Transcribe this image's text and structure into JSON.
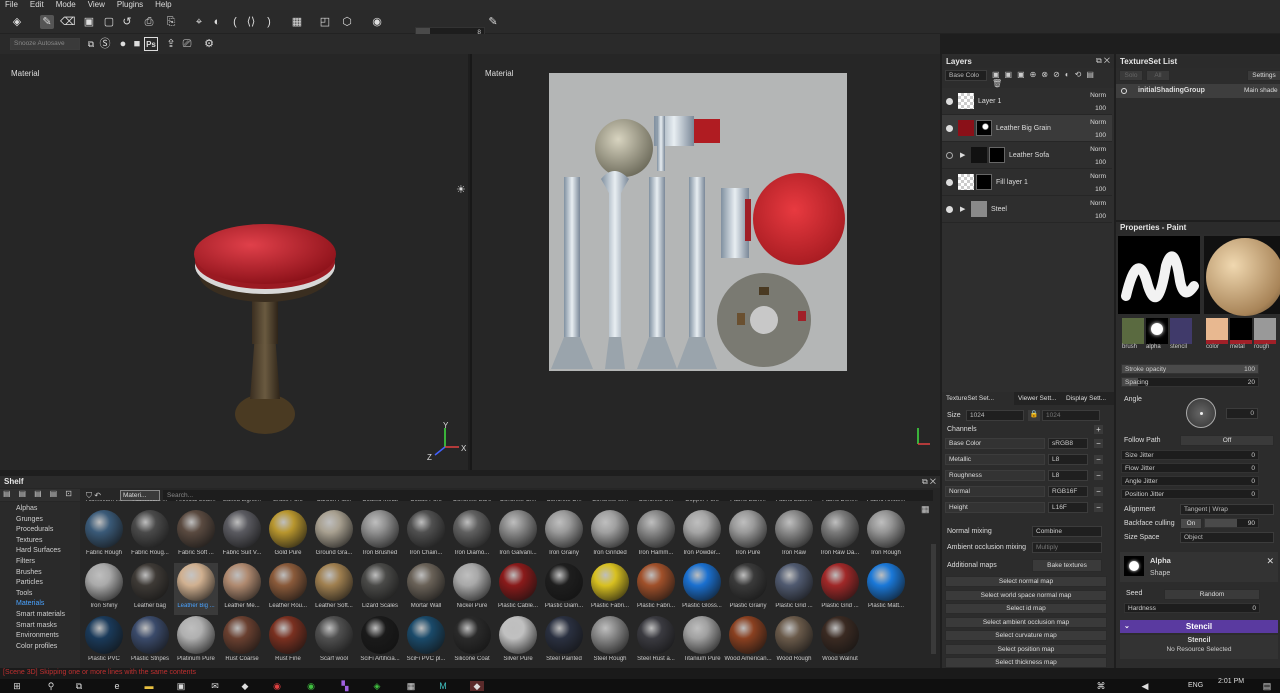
{
  "menu": [
    "File",
    "Edit",
    "Mode",
    "View",
    "Plugins",
    "Help"
  ],
  "toolbar": {
    "brush_size_value": "8",
    "search_placeholder": "Snooze Autosave"
  },
  "viewport_left": {
    "label": "Material"
  },
  "viewport_right": {
    "label": "Material"
  },
  "axes": {
    "x": "X",
    "y": "Y",
    "z": "Z"
  },
  "layers": {
    "title": "Layers",
    "channel_select": "Base Colo",
    "items": [
      {
        "name": "Layer 1",
        "blend": "Norm",
        "opacity": "100",
        "visible": true
      },
      {
        "name": "Leather Big Grain",
        "blend": "Norm",
        "opacity": "100",
        "visible": true
      },
      {
        "name": "Leather Sofa",
        "blend": "Norm",
        "opacity": "100",
        "visible": false
      },
      {
        "name": "Fill layer 1",
        "blend": "Norm",
        "opacity": "100",
        "visible": true
      },
      {
        "name": "Steel",
        "blend": "Norm",
        "opacity": "100",
        "visible": true
      }
    ]
  },
  "textureset_list": {
    "title": "TextureSet List",
    "solo": "Solo",
    "all": "All",
    "settings": "Settings",
    "item": "initialShadingGroup",
    "shader": "Main shade"
  },
  "properties": {
    "title": "Properties - Paint",
    "slot_labels": [
      "brush",
      "alpha",
      "stencil",
      "color",
      "metal",
      "rough"
    ],
    "stroke_opacity": {
      "label": "Stroke opacity",
      "value": "100"
    },
    "spacing": {
      "label": "Spacing",
      "value": "20"
    },
    "angle": {
      "label": "Angle",
      "value": "0"
    },
    "follow_path": {
      "label": "Follow Path",
      "value": "Off"
    },
    "size_jitter": {
      "label": "Size Jitter",
      "value": "0"
    },
    "flow_jitter": {
      "label": "Flow Jitter",
      "value": "0"
    },
    "angle_jitter": {
      "label": "Angle Jitter",
      "value": "0"
    },
    "position_jitter": {
      "label": "Position Jitter",
      "value": "0"
    },
    "alignment": {
      "label": "Alignment",
      "value": "Tangent | Wrap"
    },
    "backface_culling": {
      "label": "Backface culling",
      "toggle": "On",
      "value": "90"
    },
    "size_space": {
      "label": "Size Space",
      "value": "Object"
    },
    "alpha": {
      "title": "Alpha",
      "sub": "Shape"
    },
    "seed": {
      "label": "Seed",
      "value": "Random"
    },
    "hardness": {
      "label": "Hardness",
      "value": "0"
    },
    "stencil": {
      "title": "Stencil",
      "sub": "Stencil",
      "resource": "No Resource Selected"
    }
  },
  "textureset_settings": {
    "tabs": [
      "TextureSet Set...",
      "Viewer Sett...",
      "Display Sett..."
    ],
    "size_label": "Size",
    "size_value": "1024",
    "size_value2": "1024",
    "channels_label": "Channels",
    "channels": [
      {
        "name": "Base Color",
        "format": "sRGB8"
      },
      {
        "name": "Metallic",
        "format": "L8"
      },
      {
        "name": "Roughness",
        "format": "L8"
      },
      {
        "name": "Normal",
        "format": "RGB16F"
      },
      {
        "name": "Height",
        "format": "L16F"
      }
    ],
    "normal_mixing": {
      "label": "Normal mixing",
      "value": "Combine"
    },
    "ao_mixing": {
      "label": "Ambient occlusion mixing",
      "value": "Multiply"
    },
    "additional_maps": {
      "label": "Additional maps",
      "button": "Bake textures"
    },
    "map_buttons": [
      "Select normal map",
      "Select world space normal map",
      "Select id map",
      "Select ambient occlusion map",
      "Select curvature map",
      "Select position map",
      "Select thickness map"
    ]
  },
  "shelf": {
    "title": "Shelf",
    "filter_tag": "Materi...",
    "search_placeholder": "Search...",
    "categories": [
      "Alphas",
      "Grunges",
      "Procedurals",
      "Textures",
      "Hard Surfaces",
      "Filters",
      "Brushes",
      "Particles",
      "Tools",
      "Materials",
      "Smart materials",
      "Smart masks",
      "Environments",
      "Color profiles"
    ],
    "selected_category": "Materials",
    "top_cut_labels": [
      "Aluminium I...",
      "Aluminium ...",
      "Artificial Leat...",
      "Baked Lighti...",
      "Brass Pure",
      "Carbon Fiber",
      "Coated Metal",
      "Cobalt Pure",
      "Concrete Bare",
      "Concrete Cl...",
      "Concrete D...",
      "Concrete Sl...",
      "Concrete S...",
      "Copper Pure",
      "Fabric Bam...",
      "Fabric Base...",
      "Fabric Deni...",
      "Fabric Knitte..."
    ],
    "rows": [
      [
        {
          "label": "Fabric Rough",
          "color": "#3a5a78"
        },
        {
          "label": "Fabric Roug...",
          "color": "#4a4a4a"
        },
        {
          "label": "Fabric Soft ...",
          "color": "#5a4a40"
        },
        {
          "label": "Fabric Suit V...",
          "color": "#5a5a60"
        },
        {
          "label": "Gold Pure",
          "color": "#b8962e"
        },
        {
          "label": "Ground Gra...",
          "color": "#a8a090"
        },
        {
          "label": "Iron Brushed",
          "color": "#909090"
        },
        {
          "label": "Iron Chain...",
          "color": "#505050"
        },
        {
          "label": "Iron Diamo...",
          "color": "#606060"
        },
        {
          "label": "Iron Galvani...",
          "color": "#8a8a8a"
        },
        {
          "label": "Iron Grainy",
          "color": "#9a9a9a"
        },
        {
          "label": "Iron Grinded",
          "color": "#a0a0a0"
        },
        {
          "label": "Iron Hamm...",
          "color": "#8a8a8a"
        },
        {
          "label": "Iron Powder...",
          "color": "#a5a5a5"
        },
        {
          "label": "Iron Pure",
          "color": "#9a9a9a"
        },
        {
          "label": "Iron Raw",
          "color": "#8a8a8a"
        },
        {
          "label": "Iron Raw Da...",
          "color": "#7a7a7a"
        },
        {
          "label": "Iron Rough",
          "color": "#959595"
        }
      ],
      [
        {
          "label": "Iron Shiny",
          "color": "#aaaaaa"
        },
        {
          "label": "Leather bag",
          "color": "#3e3a36"
        },
        {
          "label": "Leather Big ...",
          "color": "#d0b090",
          "highlight": true
        },
        {
          "label": "Leather Me...",
          "color": "#b08a70"
        },
        {
          "label": "Leather Rou...",
          "color": "#8a5a3a"
        },
        {
          "label": "Leather Soft...",
          "color": "#a08050"
        },
        {
          "label": "Lizard Scales",
          "color": "#4a4a48"
        },
        {
          "label": "Mortar Wall",
          "color": "#6a6258"
        },
        {
          "label": "Nickel Pure",
          "color": "#a8a8a8"
        },
        {
          "label": "Plastic Cable...",
          "color": "#8a1a1a"
        },
        {
          "label": "Plastic Diam...",
          "color": "#1e1e1e"
        },
        {
          "label": "Plastic Fabri...",
          "color": "#d8c020"
        },
        {
          "label": "Plastic Fabri...",
          "color": "#a0502a"
        },
        {
          "label": "Plastic Gloss...",
          "color": "#1a70d0"
        },
        {
          "label": "Plastic Grainy",
          "color": "#3a3a3a"
        },
        {
          "label": "Plastic Grid ...",
          "color": "#505a70"
        },
        {
          "label": "Plastic Grid ...",
          "color": "#a02828"
        },
        {
          "label": "Plastic Matt...",
          "color": "#1a78d8"
        }
      ],
      [
        {
          "label": "Plastic PVC",
          "color": "#1a3a5a"
        },
        {
          "label": "Plastic Stripes",
          "color": "#3a4a6a"
        },
        {
          "label": "Platinum Pure",
          "color": "#b0b0b0"
        },
        {
          "label": "Rust Coarse",
          "color": "#6a4030"
        },
        {
          "label": "Rust Fine",
          "color": "#7a3020"
        },
        {
          "label": "Scarf wool",
          "color": "#505050"
        },
        {
          "label": "SciFi Artificia...",
          "color": "#1a1a1a"
        },
        {
          "label": "SciFi PVC pl...",
          "color": "#1a4a6a"
        },
        {
          "label": "Silicone Coat",
          "color": "#2a2a2a"
        },
        {
          "label": "Silver Pure",
          "color": "#c0c0c0"
        },
        {
          "label": "Steel Painted",
          "color": "#2a3040"
        },
        {
          "label": "Steel Rough",
          "color": "#8a8a8a"
        },
        {
          "label": "Steel Rust a...",
          "color": "#3a3a40"
        },
        {
          "label": "Titanium Pure",
          "color": "#a0a0a0"
        },
        {
          "label": "Wood American...",
          "color": "#8a4020"
        },
        {
          "label": "Wood Rough",
          "color": "#6a5a4a"
        },
        {
          "label": "Wood Walnut",
          "color": "#3a2a22"
        }
      ]
    ]
  },
  "status": {
    "message": "[Scene 3D] Skipping one or more lines with the same contents"
  },
  "taskbar": {
    "time": "2:01 PM",
    "lang": "ENG"
  }
}
